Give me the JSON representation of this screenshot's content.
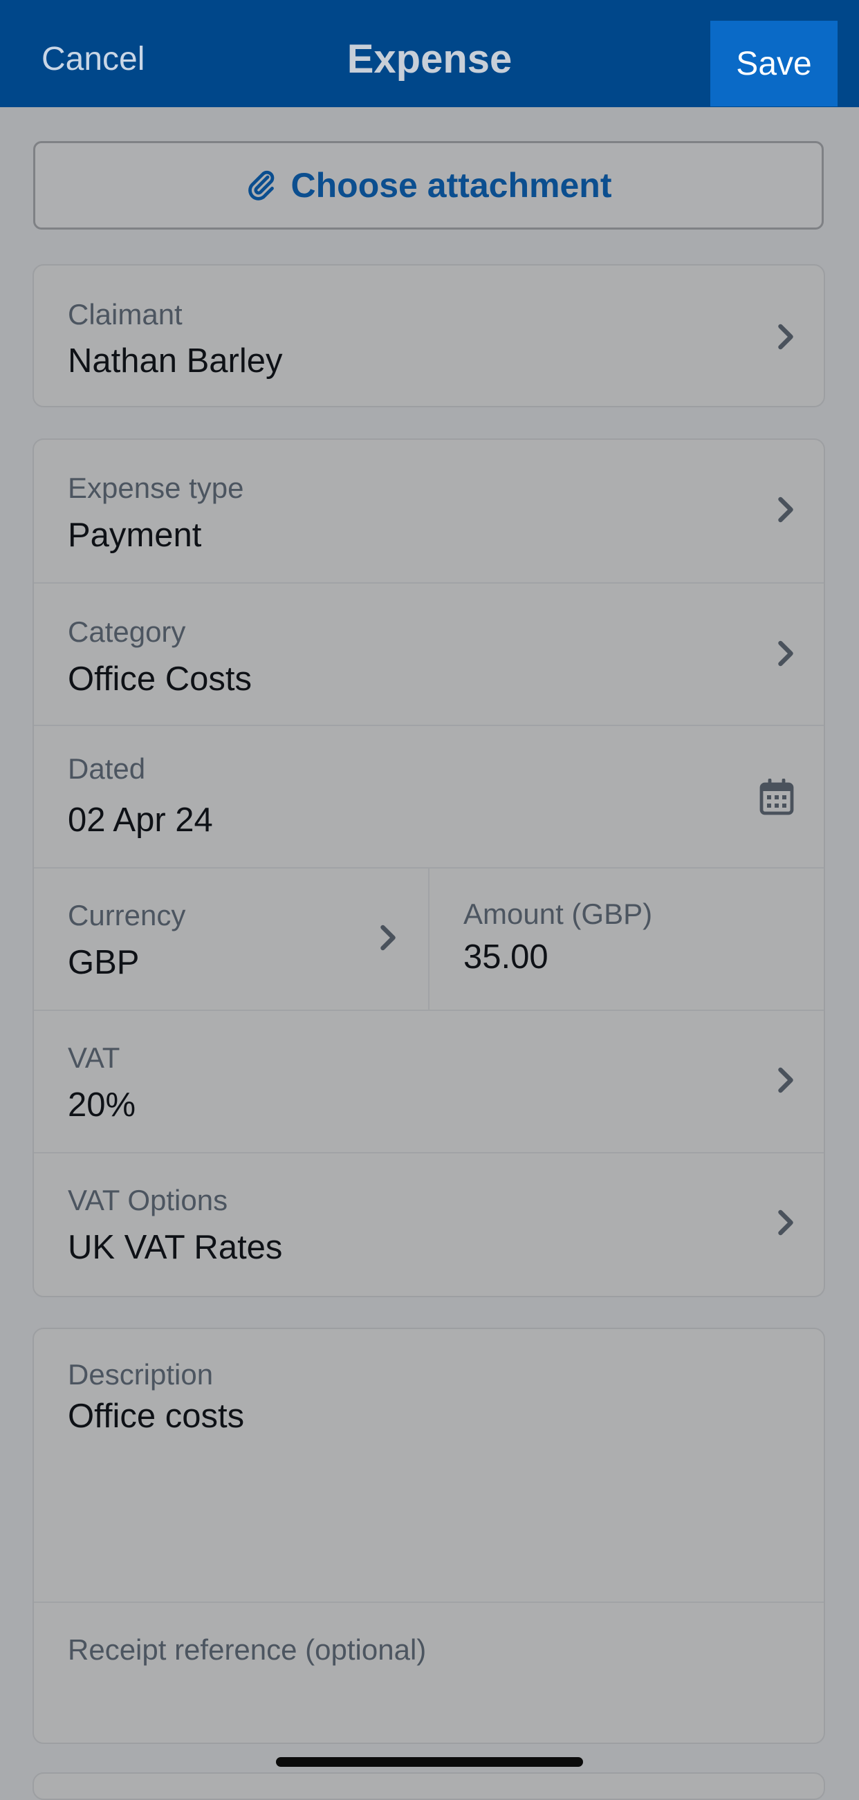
{
  "header": {
    "cancel_label": "Cancel",
    "title": "Expense",
    "save_label": "Save"
  },
  "attachment": {
    "label": "Choose attachment",
    "icon": "paperclip-icon"
  },
  "claimant": {
    "label": "Claimant",
    "value": "Nathan Barley"
  },
  "details": {
    "expense_type": {
      "label": "Expense type",
      "value": "Payment"
    },
    "category": {
      "label": "Category",
      "value": "Office Costs"
    },
    "dated": {
      "label": "Dated",
      "value": "02 Apr 24",
      "icon": "calendar-icon"
    },
    "currency": {
      "label": "Currency",
      "value": "GBP"
    },
    "amount": {
      "label": "Amount (GBP)",
      "value": "35.00"
    },
    "vat": {
      "label": "VAT",
      "value": "20%"
    },
    "vat_options": {
      "label": "VAT Options",
      "value": "UK VAT Rates"
    }
  },
  "notes": {
    "description": {
      "label": "Description",
      "value": "Office costs"
    },
    "receipt_reference": {
      "placeholder": "Receipt reference (optional)"
    }
  },
  "colors": {
    "header_bg": "#00478a",
    "save_bg": "#0a6ac7",
    "accent_text": "#0b4e8f",
    "overlay_bg": "#a9abae"
  }
}
